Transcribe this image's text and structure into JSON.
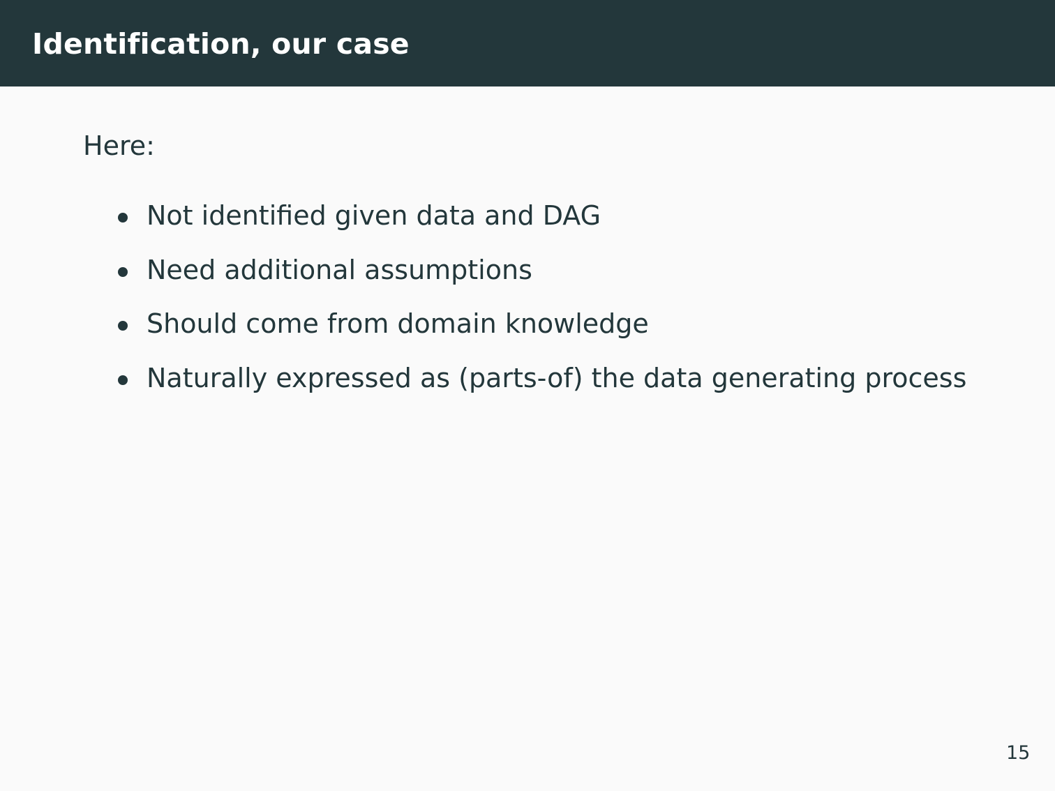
{
  "slide": {
    "title": "Identification, our case",
    "intro": "Here:",
    "bullets": [
      "Not identified given data and DAG",
      "Need additional assumptions",
      "Should come from domain knowledge",
      "Naturally expressed as (parts-of) the data generating process"
    ],
    "page_number": "15"
  },
  "colors": {
    "header_background": "#23373b",
    "slide_background": "#fafafa",
    "text": "#23373b",
    "title_text": "#ffffff"
  }
}
